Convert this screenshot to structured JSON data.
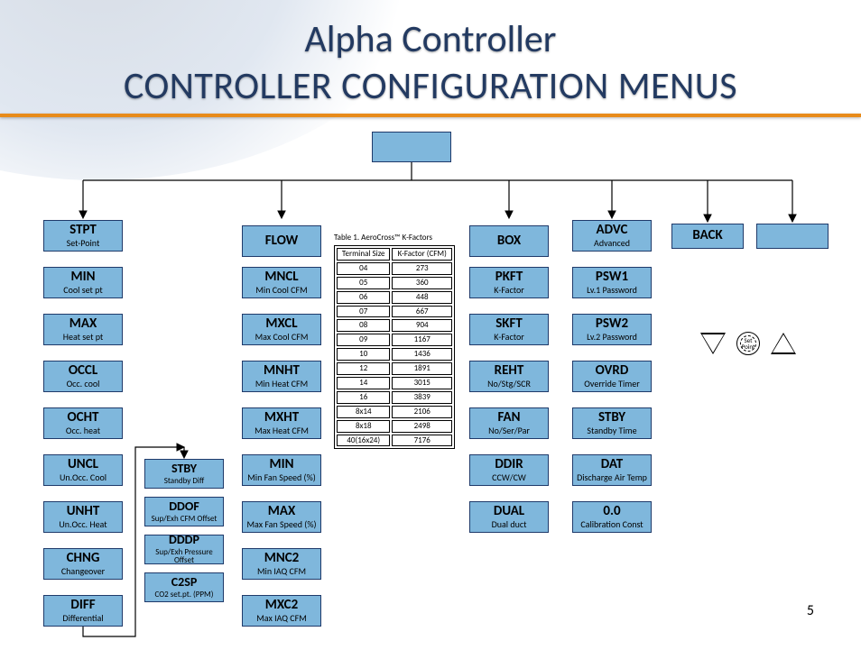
{
  "title": "Alpha Controller",
  "subtitle": "CONTROLLER CONFIGURATION MENUS",
  "slide_number": "5",
  "root": {
    "code": "",
    "desc": ""
  },
  "columns": {
    "c1": {
      "head": "STPT",
      "head_desc": "Set-Point",
      "items": [
        {
          "code": "MIN",
          "desc": "Cool set pt"
        },
        {
          "code": "MAX",
          "desc": "Heat set pt"
        },
        {
          "code": "OCCL",
          "desc": "Occ. cool"
        },
        {
          "code": "OCHT",
          "desc": "Occ. heat"
        },
        {
          "code": "UNCL",
          "desc": "Un.Occ. Cool"
        },
        {
          "code": "UNHT",
          "desc": "Un.Occ. Heat"
        },
        {
          "code": "CHNG",
          "desc": "Changeover"
        },
        {
          "code": "DIFF",
          "desc": "Differential"
        }
      ]
    },
    "c2": {
      "items": [
        {
          "code": "STBY",
          "desc": "Standby Diff"
        },
        {
          "code": "DDOF",
          "desc": "Sup/Exh CFM Offset"
        },
        {
          "code": "DDDP",
          "desc": "Sup/Exh Pressure Offset"
        },
        {
          "code": "C2SP",
          "desc": "CO2 set.pt. (PPM)"
        }
      ]
    },
    "c3": {
      "head": "FLOW",
      "head_desc": "",
      "items": [
        {
          "code": "MNCL",
          "desc": "Min Cool CFM"
        },
        {
          "code": "MXCL",
          "desc": "Max Cool CFM"
        },
        {
          "code": "MNHT",
          "desc": "Min Heat CFM"
        },
        {
          "code": "MXHT",
          "desc": "Max Heat CFM"
        },
        {
          "code": "MIN",
          "desc": "Min Fan Speed (%)"
        },
        {
          "code": "MAX",
          "desc": "Max Fan Speed (%)"
        },
        {
          "code": "MNC2",
          "desc": "Min IAQ CFM"
        },
        {
          "code": "MXC2",
          "desc": "Max IAQ CFM"
        }
      ]
    },
    "c4": {
      "head": "BOX",
      "head_desc": "",
      "items": [
        {
          "code": "PKFT",
          "desc": "K-Factor"
        },
        {
          "code": "SKFT",
          "desc": "K-Factor"
        },
        {
          "code": "REHT",
          "desc": "No/Stg/SCR"
        },
        {
          "code": "FAN",
          "desc": "No/Ser/Par"
        },
        {
          "code": "DDIR",
          "desc": "CCW/CW"
        },
        {
          "code": "DUAL",
          "desc": "Dual duct"
        }
      ]
    },
    "c5": {
      "head": "ADVC",
      "head_desc": "Advanced",
      "items": [
        {
          "code": "PSW1",
          "desc": "Lv.1 Password"
        },
        {
          "code": "PSW2",
          "desc": "Lv.2 Password"
        },
        {
          "code": "OVRD",
          "desc": "Override Timer"
        },
        {
          "code": "STBY",
          "desc": "Standby Time"
        },
        {
          "code": "DAT",
          "desc": "Discharge Air Temp"
        },
        {
          "code": "0.0",
          "desc": "Calibration Const"
        }
      ]
    },
    "c6": {
      "head": "BACK"
    },
    "c7": {
      "head": ""
    }
  },
  "kfactor": {
    "caption": "Table 1. AeroCross™ K-Factors",
    "col1": "Terminal Size",
    "col2": "K-Factor (CFM)",
    "rows": [
      {
        "s": "04",
        "k": "273"
      },
      {
        "s": "05",
        "k": "360"
      },
      {
        "s": "06",
        "k": "448"
      },
      {
        "s": "07",
        "k": "667"
      },
      {
        "s": "08",
        "k": "904"
      },
      {
        "s": "09",
        "k": "1167"
      },
      {
        "s": "10",
        "k": "1436"
      },
      {
        "s": "12",
        "k": "1891"
      },
      {
        "s": "14",
        "k": "3015"
      },
      {
        "s": "16",
        "k": "3839"
      },
      {
        "s": "8x14",
        "k": "2106"
      },
      {
        "s": "8x18",
        "k": "2498"
      },
      {
        "s": "40(16x24)",
        "k": "7176"
      }
    ]
  },
  "setpoint_label": "Set Point"
}
